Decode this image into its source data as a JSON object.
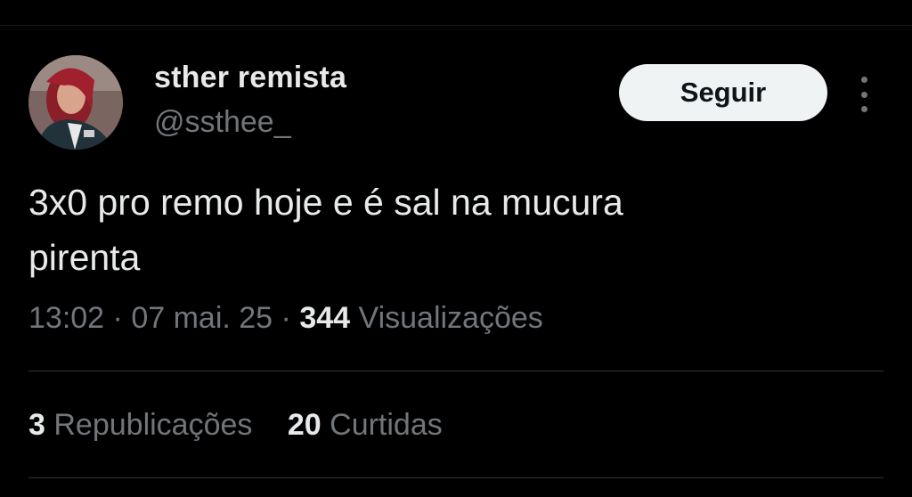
{
  "author": {
    "display_name": "sther remista",
    "handle": "@ssthee_"
  },
  "follow_button": {
    "label": "Seguir"
  },
  "tweet": {
    "text_line1": "3x0 pro remo hoje e é sal na mucura",
    "text_line2": "pirenta"
  },
  "meta": {
    "time": "13:02",
    "separator": "·",
    "date": "07 mai. 25",
    "views_count": "344",
    "views_label": "Visualizações"
  },
  "stats": {
    "reposts_count": "3",
    "reposts_label": "Republicações",
    "likes_count": "20",
    "likes_label": "Curtidas"
  },
  "colors": {
    "background": "#000000",
    "text_primary": "#e7e9ea",
    "text_secondary": "#71767b",
    "button_bg": "#eff3f4",
    "divider": "#2f3336"
  },
  "icons": {
    "more": "more-vertical-icon"
  }
}
